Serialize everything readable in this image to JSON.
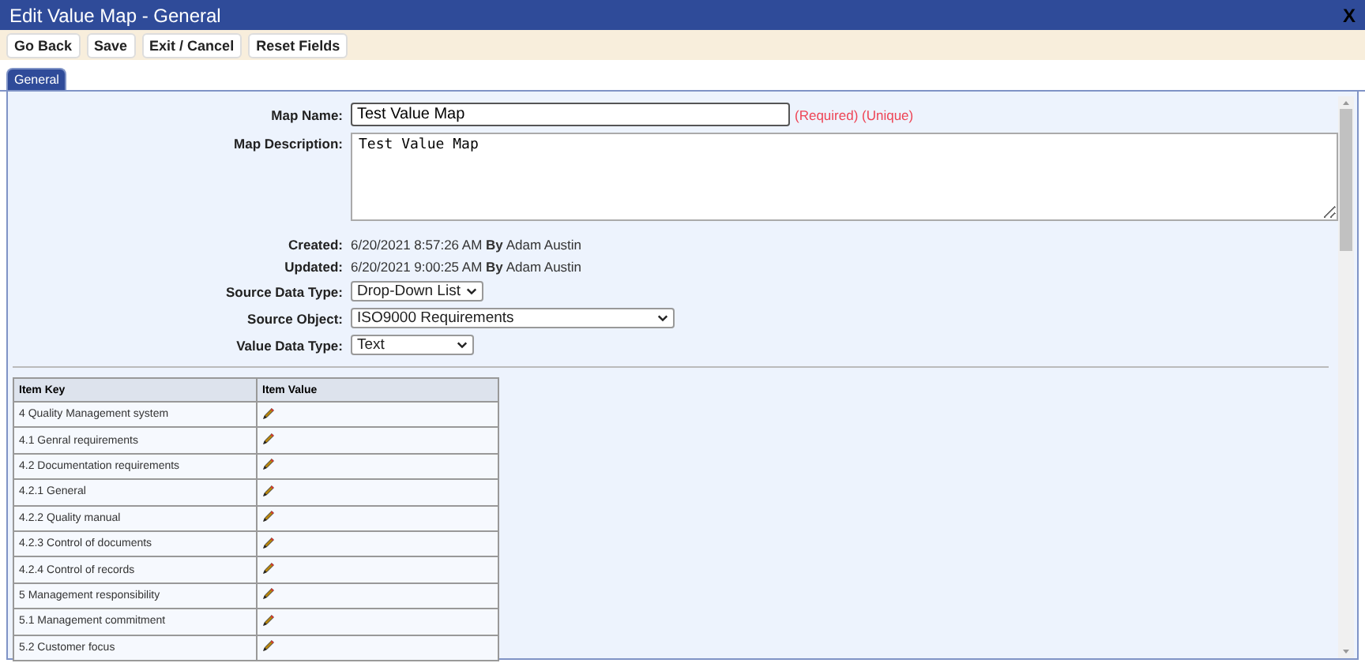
{
  "window": {
    "title": "Edit Value Map - General",
    "close": "X"
  },
  "toolbar": [
    "Go Back",
    "Save",
    "Exit / Cancel",
    "Reset Fields"
  ],
  "tabs": [
    {
      "label": "General",
      "selected": true
    }
  ],
  "form": [
    {
      "kind": "input",
      "label": "Map Name:",
      "value": "Test Value Map",
      "note": "(Required) (Unique)"
    },
    {
      "kind": "textarea",
      "label": "Map Description:",
      "value": "Test Value Map"
    },
    {
      "kind": "info",
      "label": "Created:",
      "value": "6/20/2021 8:57:26 AM **By** Adam Austin"
    },
    {
      "kind": "info",
      "label": "Updated:",
      "value": "6/20/2021 9:00:25 AM **By** Adam Austin"
    },
    {
      "kind": "select",
      "label": "Source Data Type:",
      "value": "Drop-Down List"
    },
    {
      "kind": "select",
      "label": "Source Object:",
      "value": "ISO9000 Requirements"
    },
    {
      "kind": "select",
      "label": "Value Data Type:",
      "value": "Text"
    }
  ],
  "table": {
    "columns": [
      "Item Key",
      "Item Value"
    ],
    "rows": [
      {
        "key": "4 Quality Management system"
      },
      {
        "key": "4.1 Genral requirements"
      },
      {
        "key": "4.2 Documentation requirements"
      },
      {
        "key": "4.2.1 General"
      },
      {
        "key": "4.2.2 Quality manual"
      },
      {
        "key": "4.2.3 Control of documents"
      },
      {
        "key": "4.2.4 Control of records"
      },
      {
        "key": "5 Management responsibility"
      },
      {
        "key": "5.1 Management commitment"
      },
      {
        "key": "5.2 Customer focus"
      }
    ]
  }
}
